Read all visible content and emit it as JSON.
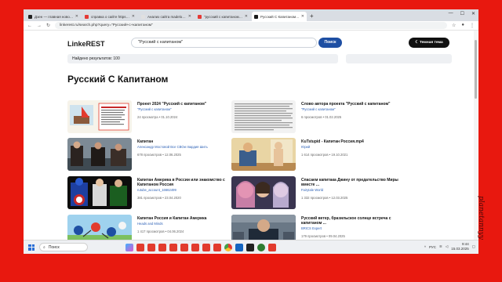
{
  "browser": {
    "tabs": [
      {
        "label": "Дзен — главная новостная и...",
        "fav_color": "#222222",
        "active": false
      },
      {
        "label": "справка о сайте https://madel...",
        "fav_color": "#e53935",
        "active": false
      },
      {
        "label": "Анализ сайта madelonne.ru",
        "fav_color": "#e0e0e0",
        "active": false
      },
      {
        "label": "\"русский с капитаном\" — Янде...",
        "fav_color": "#e53935",
        "active": false
      },
      {
        "label": "Русский С Капитаном - Поиск",
        "fav_color": "#1a1a1a",
        "active": true
      }
    ],
    "new_tab": "+",
    "url": "linkerest.ru/search.php?query=\"Русский+с+капитаном\""
  },
  "header": {
    "logo": "LinkeREST",
    "search_value": "\"Русский с капитаном\"",
    "search_button": "Поиск",
    "theme_button": "☾ Темная тема"
  },
  "results": {
    "found_text": "Найдено результатов: 100",
    "page_title": "Русский С Капитаном",
    "cards": [
      {
        "title": "Проект 2024 \"Русский с капитаном\"",
        "channel": "\"Русский с капитаном\"",
        "meta": "24 просмотра • 01.10.2024"
      },
      {
        "title": "Слово автора проекта \"Русский с капитаном\"",
        "channel": "\"Русский с капитаном\"",
        "meta": "6 просмотров • 01.02.2025"
      },
      {
        "title": "Капитан",
        "channel": "Александр Мостовой Все СВОи гвардия Шить",
        "meta": "678 просмотров • 12.06.2025"
      },
      {
        "title": "KuTstupid - Капитан Россия.mp4",
        "channel": "Юрий",
        "meta": "1 614 просмотров • 19.10.2021"
      },
      {
        "title": "Капитан Америка в России или знакомство с Капитаном Россия",
        "channel": "rutube_account_16662499",
        "meta": "381 просмотров • 23.04.2020"
      },
      {
        "title": "Спасаем капитака Джину от предательство Миры вместе ...",
        "channel": "Fairytale World",
        "meta": "1 332 просмотров • 12.03.2025"
      },
      {
        "title": "Капитан Россия и Капитан Америка",
        "channel": "Heads and Minds",
        "meta": "1 417 просмотров • 04.06.2024"
      },
      {
        "title": "Русский ветер, бразильское солнце встреча с капитаном ...",
        "channel": "BRICS Expert",
        "meta": "179 просмотров • 09.04.2025"
      }
    ]
  },
  "taskbar": {
    "search_label": "Поиск",
    "lang": "РУС",
    "time": "9:44",
    "date": "15.03.2025"
  },
  "watermark": "planetannyy",
  "colors": {
    "frame": "#e8180f",
    "accent": "#1e4fa3"
  }
}
